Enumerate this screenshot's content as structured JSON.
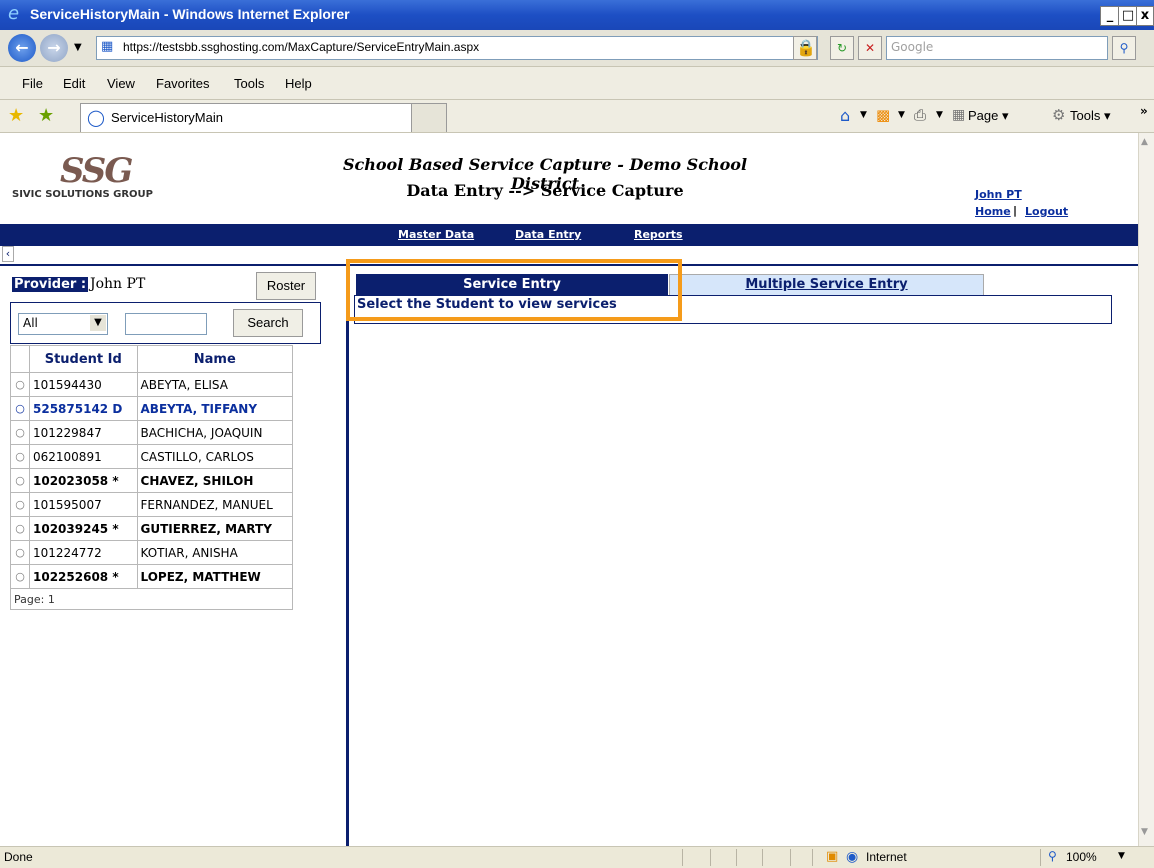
{
  "window": {
    "title": "ServiceHistoryMain - Windows Internet Explorer",
    "controls": [
      "_",
      "□",
      "x"
    ]
  },
  "address": {
    "url": "https://testsbb.ssghosting.com/MaxCapture/ServiceEntryMain.aspx",
    "search_placeholder": "Google"
  },
  "menu": [
    "File",
    "Edit",
    "View",
    "Favorites",
    "Tools",
    "Help"
  ],
  "favorites": {
    "tab_title": "ServiceHistoryMain",
    "tools": [
      "Page ▾",
      "Tools ▾"
    ]
  },
  "header": {
    "logo_text": "SSG",
    "logo_sub": "SIVIC SOLUTIONS GROUP",
    "title": "School Based Service Capture - Demo School District",
    "subtitle": "Data Entry --> Service Capture",
    "user": "John PT",
    "home": "Home",
    "separator": "|",
    "logout": "Logout"
  },
  "nav": [
    "Master Data",
    "Data Entry",
    "Reports"
  ],
  "left": {
    "collapse": "‹",
    "provider_label": "Provider :",
    "provider_name": "John PT",
    "roster_btn": "Roster",
    "filter_value": "All",
    "search_btn": "Search",
    "columns": [
      "Student Id",
      "Name"
    ],
    "students": [
      {
        "id": "101594430",
        "name": "ABEYTA, ELISA",
        "style": "normal"
      },
      {
        "id": "525875142 D",
        "name": "ABEYTA, TIFFANY",
        "style": "blue"
      },
      {
        "id": "101229847",
        "name": "BACHICHA, JOAQUIN",
        "style": "normal"
      },
      {
        "id": "062100891",
        "name": "CASTILLO, CARLOS",
        "style": "normal"
      },
      {
        "id": "102023058 *",
        "name": "CHAVEZ, SHILOH",
        "style": "bold"
      },
      {
        "id": "101595007",
        "name": "FERNANDEZ, MANUEL",
        "style": "normal"
      },
      {
        "id": "102039245 *",
        "name": "GUTIERREZ, MARTY",
        "style": "bold"
      },
      {
        "id": "101224772",
        "name": "KOTIAR, ANISHA",
        "style": "normal"
      },
      {
        "id": "102252608 *",
        "name": "LOPEZ, MATTHEW",
        "style": "bold"
      }
    ],
    "page_label": "Page: 1"
  },
  "right": {
    "tab_active": "Service Entry",
    "tab_other": "Multiple Service Entry",
    "message": "Select the Student to view services"
  },
  "status": {
    "text": "Done",
    "zone": "Internet",
    "zoom": "100%"
  },
  "colors": {
    "navy": "#0b1f6e",
    "highlight": "#f59b1a",
    "tab_inactive": "#d6e6fa"
  }
}
